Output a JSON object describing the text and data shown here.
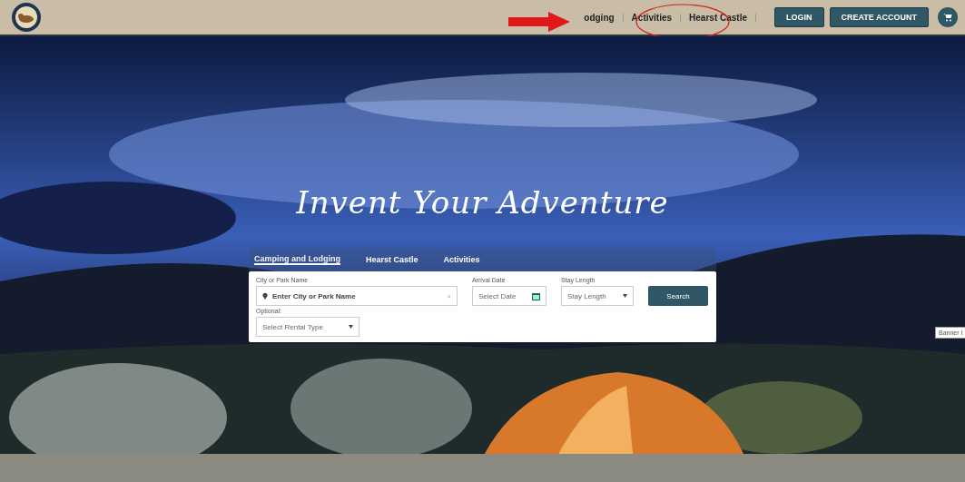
{
  "header": {
    "nav": [
      {
        "label": "odging"
      },
      {
        "label": "Activities"
      },
      {
        "label": "Hearst Castle"
      }
    ],
    "buttons": [
      "LOGIN",
      "CREATE ACCOUNT"
    ]
  },
  "hero": {
    "kind": "picture",
    "title": "Invent Your Adventure",
    "tabs": [
      {
        "label": "Camping and Lodging",
        "selected": true
      },
      {
        "label": "Hearst Castle",
        "selected": false
      },
      {
        "label": "Activities",
        "selected": false
      }
    ],
    "form": {
      "location": {
        "label": "City or Park Name",
        "placeholder": "Enter City or Park Name",
        "clear": "×"
      },
      "arrival": {
        "label": "Arrival Date",
        "placeholder": "Select Date"
      },
      "stay": {
        "label": "Stay Length",
        "value": "Stay Length"
      },
      "search": "Search",
      "rental": {
        "label": "Optional:",
        "value": "Select Rental Type"
      }
    },
    "tooltip": "Banner I"
  }
}
